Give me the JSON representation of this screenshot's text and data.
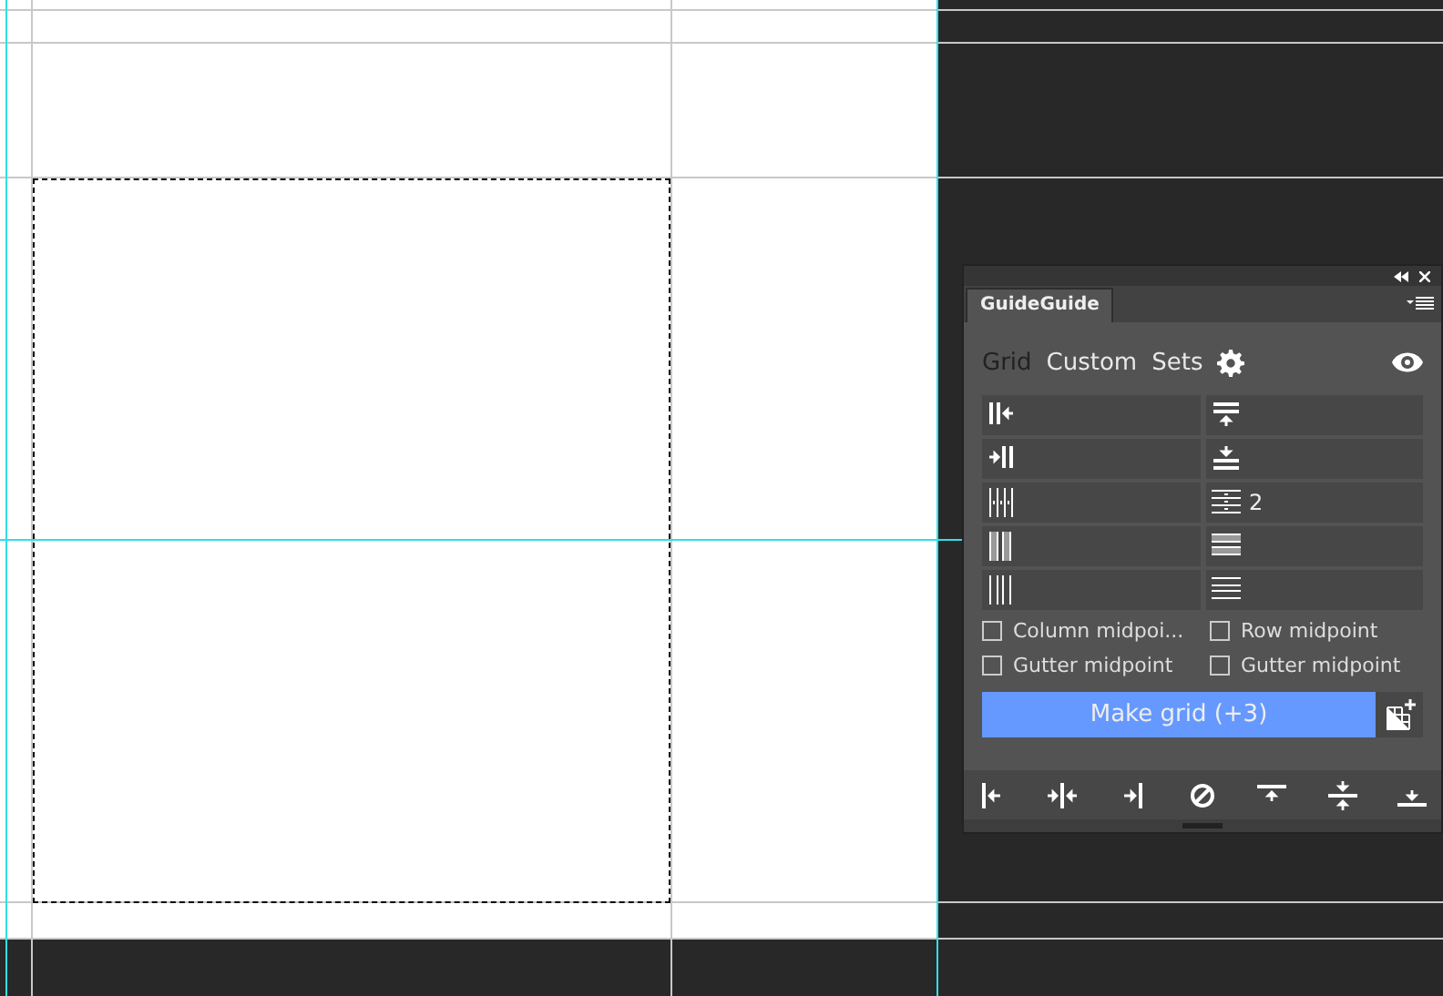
{
  "panel": {
    "title": "GuideGuide",
    "tabs": [
      {
        "label": "Grid",
        "selected": true
      },
      {
        "label": "Custom",
        "selected": false
      },
      {
        "label": "Sets",
        "selected": false
      }
    ],
    "fields": [
      {
        "kind": "margin-left"
      },
      {
        "kind": "margin-top"
      },
      {
        "kind": "margin-right"
      },
      {
        "kind": "margin-bottom"
      },
      {
        "kind": "columns"
      },
      {
        "kind": "rows",
        "value": "2"
      },
      {
        "kind": "column-width"
      },
      {
        "kind": "row-height"
      },
      {
        "kind": "column-gutter"
      },
      {
        "kind": "row-gutter"
      }
    ],
    "checkboxes": [
      {
        "label": "Column midpoi...",
        "checked": false
      },
      {
        "label": "Row midpoint",
        "checked": false
      },
      {
        "label": "Gutter midpoint",
        "checked": false
      },
      {
        "label": "Gutter midpoint",
        "checked": false
      }
    ],
    "make_button": "Make grid (+3)"
  }
}
